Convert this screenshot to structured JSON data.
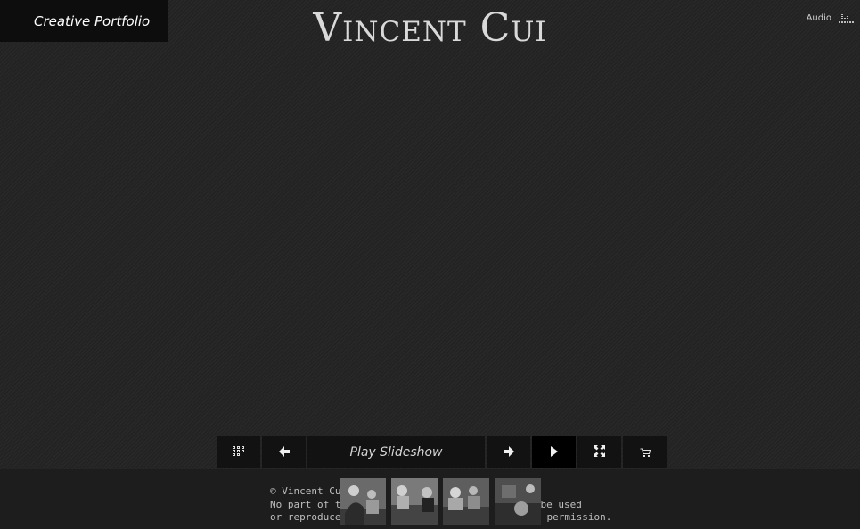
{
  "menu": {
    "label": "Creative Portfolio"
  },
  "header": {
    "title": "Vincent Cui"
  },
  "audio": {
    "label": "Audio",
    "icon": "equalizer-icon"
  },
  "controls": {
    "grid_icon": "grid-icon",
    "prev_icon": "arrow-left-icon",
    "play_label": "Play Slideshow",
    "next_icon": "arrow-right-icon",
    "play_icon": "play-icon",
    "fullscreen_icon": "fullscreen-icon",
    "cart_icon": "cart-icon"
  },
  "footer": {
    "copyright_lines": [
      "© Vincent Cu",
      "No part of t",
      "or reproduce"
    ],
    "copyright_tail": [
      "be used",
      "permission."
    ]
  },
  "thumbnails": [
    {
      "name": "thumbnail-1"
    },
    {
      "name": "thumbnail-2"
    },
    {
      "name": "thumbnail-3"
    },
    {
      "name": "thumbnail-4"
    }
  ],
  "colors": {
    "background": "#232323",
    "menu_bg": "#0d0d0d",
    "control_bg": "#121212",
    "footer_bg": "#1d1d1d",
    "title": "#d9d9d9"
  }
}
